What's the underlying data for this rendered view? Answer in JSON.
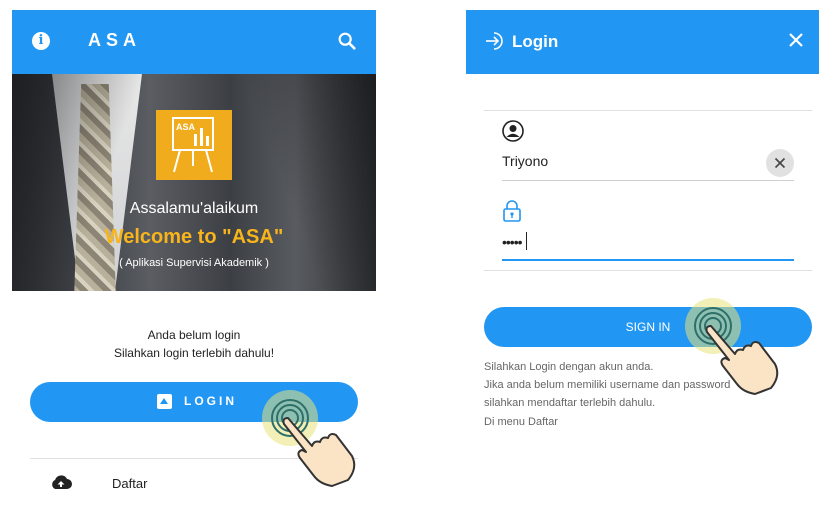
{
  "left_screen": {
    "app_title": "ASA",
    "hero": {
      "greeting": "Assalamu'alaikum",
      "welcome": "Welcome to \"ASA\"",
      "subtitle": "( Aplikasi Supervisi Akademik )",
      "logo_text": "ASA"
    },
    "message_line1": "Anda belum login",
    "message_line2": "Silahkan login terlebih dahulu!",
    "login_button_label": "LOGIN",
    "menu_item_label": "Daftar"
  },
  "right_screen": {
    "title": "Login",
    "username_value": "Triyono",
    "password_value": "•••••",
    "signin_label": "SIGN IN",
    "hint_line1": "Silahkan Login dengan akun anda.",
    "hint_line2": "Jika anda belum memiliki username dan password",
    "hint_line3": "silahkan mendaftar terlebih dahulu.",
    "hint_line4": "Di menu Daftar"
  },
  "colors": {
    "primary": "#2196f3",
    "accent_yellow": "#f7b51b",
    "logo_orange": "#f0ac1c"
  },
  "icons": [
    "info-icon",
    "search-icon",
    "cloud-upload-icon",
    "login-icon",
    "close-icon",
    "user-icon",
    "lock-icon",
    "clear-icon",
    "hand-pointer-icon"
  ]
}
